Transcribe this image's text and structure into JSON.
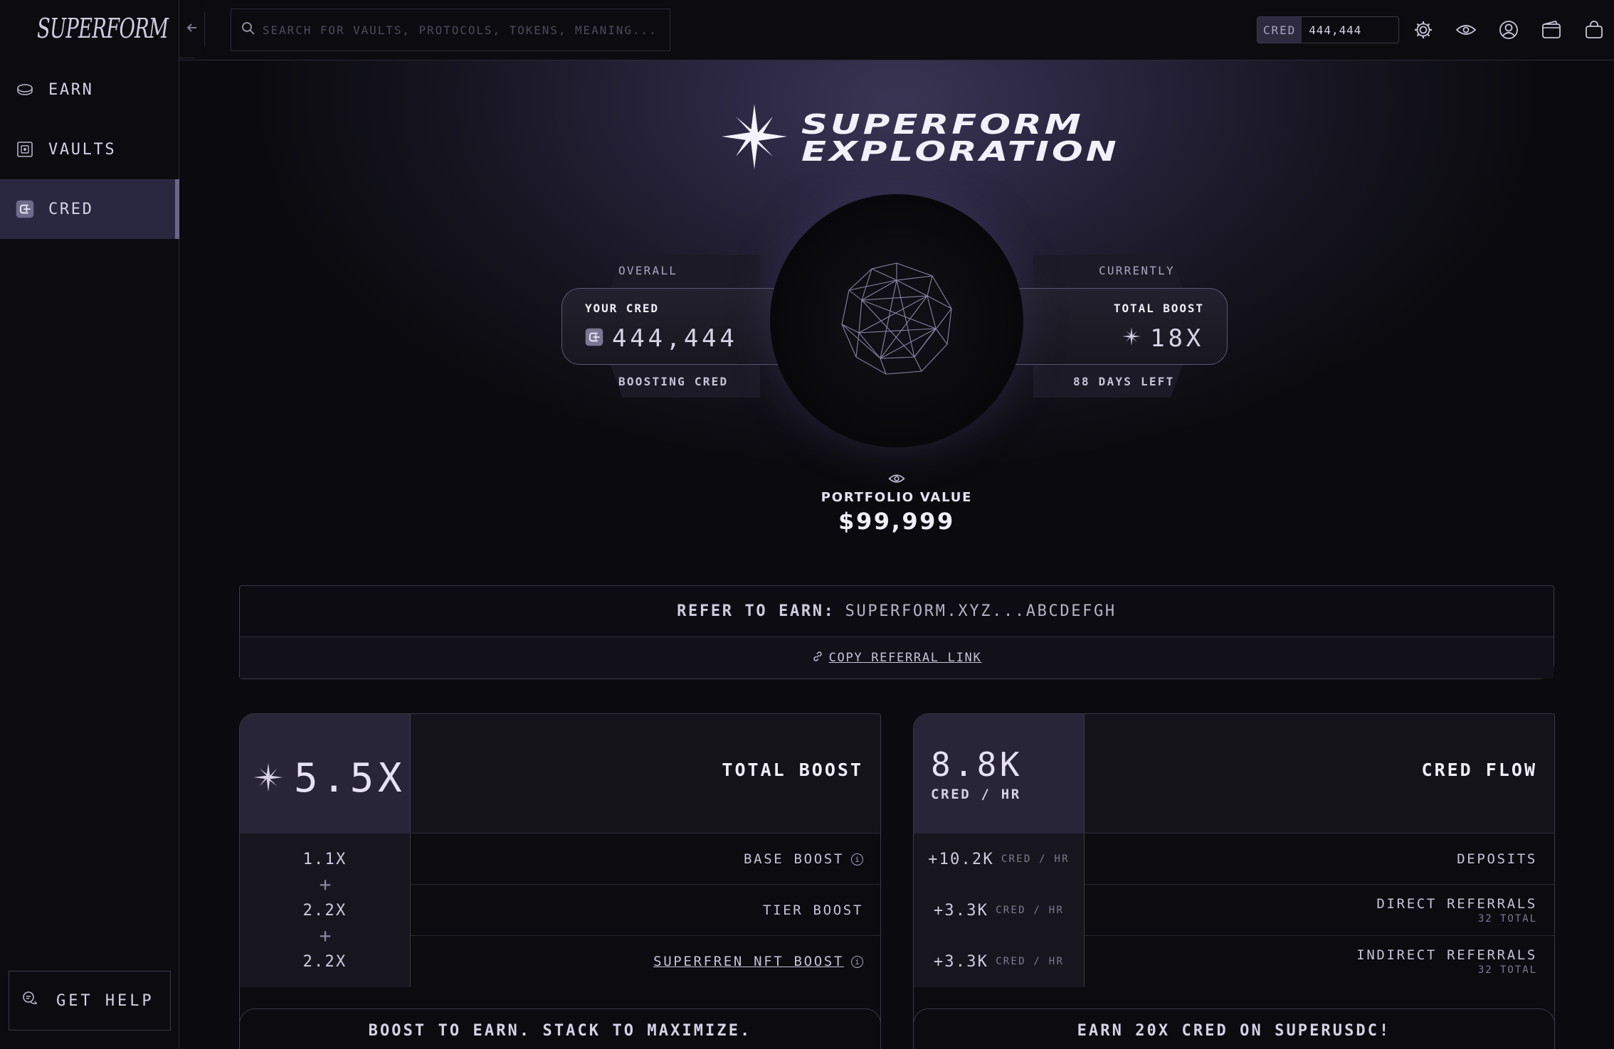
{
  "app": {
    "logo": "SUPERFORM"
  },
  "sidebar": {
    "items": [
      {
        "label": "EARN",
        "icon": "coin-icon",
        "active": false
      },
      {
        "label": "VAULTS",
        "icon": "vault-icon",
        "active": false
      },
      {
        "label": "CRED",
        "icon": "cred-icon",
        "active": true
      }
    ],
    "help_label": "GET HELP"
  },
  "header": {
    "search_placeholder": "SEARCH FOR VAULTS, PROTOCOLS, TOKENS, MEANING...",
    "cred_label": "CRED",
    "cred_value": "444,444",
    "icons": [
      "gear-icon",
      "eye-icon",
      "user-icon",
      "wallet-icon",
      "bag-icon"
    ]
  },
  "hero": {
    "title_line1": "SUPERFORM",
    "title_line2": "EXPLORATION"
  },
  "stats": {
    "left": {
      "over": "OVERALL",
      "small": "YOUR CRED",
      "value": "444,444",
      "under": "BOOSTING CRED"
    },
    "right": {
      "over": "CURRENTLY",
      "small": "TOTAL BOOST",
      "value": "18X",
      "under": "88 DAYS LEFT"
    }
  },
  "portfolio": {
    "label": "PORTFOLIO VALUE",
    "value": "$99,999"
  },
  "refer": {
    "label": "REFER TO EARN:",
    "value": "SUPERFORM.XYZ...ABCDEFGH",
    "copy_label": "COPY REFERRAL LINK"
  },
  "boost_card": {
    "value": "5.5X",
    "title": "TOTAL BOOST",
    "rows": [
      {
        "value": "1.1X",
        "label": "BASE BOOST"
      },
      {
        "value": "2.2X",
        "label": "TIER BOOST"
      },
      {
        "value": "2.2X",
        "label": "SUPERFREN NFT BOOST"
      }
    ]
  },
  "flow_card": {
    "value": "8.8K",
    "unit": "CRED / HR",
    "title": "CRED FLOW",
    "rows": [
      {
        "value": "+10.2K",
        "unit": "CRED / HR",
        "label": "DEPOSITS",
        "sub": ""
      },
      {
        "value": "+3.3K",
        "unit": "CRED / HR",
        "label": "DIRECT REFERRALS",
        "sub": "32 TOTAL"
      },
      {
        "value": "+3.3K",
        "unit": "CRED / HR",
        "label": "INDIRECT REFERRALS",
        "sub": "32 TOTAL"
      }
    ]
  },
  "bottom": {
    "left": "BOOST TO EARN. STACK TO MAXIMIZE.",
    "right": "EARN 20X CRED ON SUPERUSDC!"
  }
}
